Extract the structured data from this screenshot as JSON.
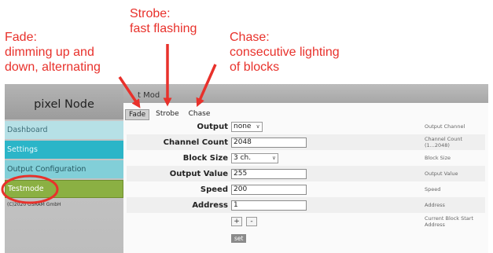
{
  "annotations": {
    "fade": "Fade:\ndimming up and\ndown, alternating",
    "strobe": "Strobe:\nfast flashing",
    "chase": "Chase:\nconsecutive lighting\nof blocks"
  },
  "colors": {
    "annotation": "#e8312b",
    "testmode": "#8bb043",
    "settings": "#2bb5c8"
  },
  "sidebar": {
    "brand": "pixel Node",
    "items": [
      {
        "label": "Dashboard"
      },
      {
        "label": "Settings"
      },
      {
        "label": "Output Configuration"
      },
      {
        "label": "Testmode",
        "active": true
      }
    ],
    "copyright": "(C)2020 OSRAM GmbH"
  },
  "main": {
    "header": "t Mod",
    "tabs": [
      {
        "label": "Fade",
        "active": true
      },
      {
        "label": "Strobe"
      },
      {
        "label": "Chase"
      }
    ]
  },
  "form": {
    "output": {
      "label": "Output",
      "value": "none",
      "desc": "Output Channel"
    },
    "channel_count": {
      "label": "Channel Count",
      "value": "2048",
      "desc": "Channel Count (1...2048)"
    },
    "block_size": {
      "label": "Block Size",
      "value": "3 ch.",
      "desc": "Block Size"
    },
    "output_value": {
      "label": "Output Value",
      "value": "255",
      "desc": "Output Value"
    },
    "speed": {
      "label": "Speed",
      "value": "200",
      "desc": "Speed"
    },
    "address": {
      "label": "Address",
      "value": "1",
      "desc": "Address"
    },
    "block_start": {
      "plus": "+",
      "minus": "-",
      "desc": "Current Block Start Address"
    },
    "set_label": "set"
  }
}
